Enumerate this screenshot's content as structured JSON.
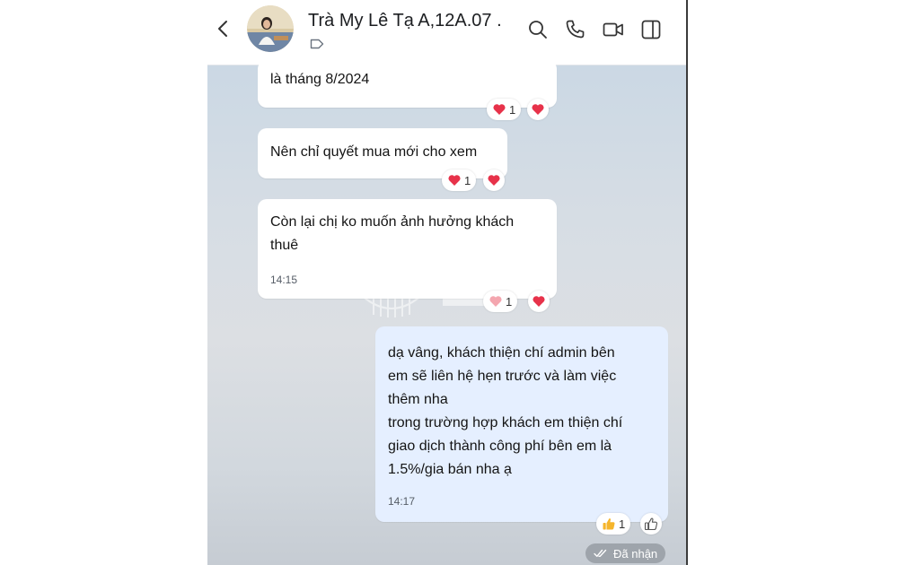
{
  "header": {
    "contact_name": "Trà My Lê Tạ A,12A.07 ."
  },
  "messages": [
    {
      "id": "m1",
      "text": "là tháng 8/2024",
      "reaction_count": "1"
    },
    {
      "id": "m2",
      "text": "Nên chỉ quyết mua mới cho xem",
      "reaction_count": "1"
    },
    {
      "id": "m3",
      "lines": [
        "Còn lại chị ko muốn ảnh hưởng khách",
        "thuê"
      ],
      "time": "14:15",
      "reaction_count": "1"
    },
    {
      "id": "m4",
      "lines": [
        "dạ vâng, khách thiện chí admin bên",
        "em sẽ liên hệ hẹn trước và làm việc",
        "thêm nha",
        "trong trường hợp khách em thiện chí",
        "giao dịch thành công phí bên em là",
        "1.5%/gia bán nha ạ"
      ],
      "time": "14:17",
      "reaction_count": "1"
    }
  ],
  "status": {
    "label": "Đã nhận"
  },
  "icons": {
    "back": "chevron-left-icon",
    "tag": "tag-icon",
    "search": "search-icon",
    "call": "phone-icon",
    "video": "video-camera-icon",
    "panel": "sidebar-toggle-icon",
    "heart": "heart-icon",
    "like": "thumbs-up-icon",
    "double_check": "double-check-icon"
  },
  "colors": {
    "heart": "#e7324a",
    "like": "#f5b52c",
    "outgoing_bubble": "#e5efff",
    "incoming_bubble": "#ffffff",
    "status_pill": "#9ea4ab"
  }
}
